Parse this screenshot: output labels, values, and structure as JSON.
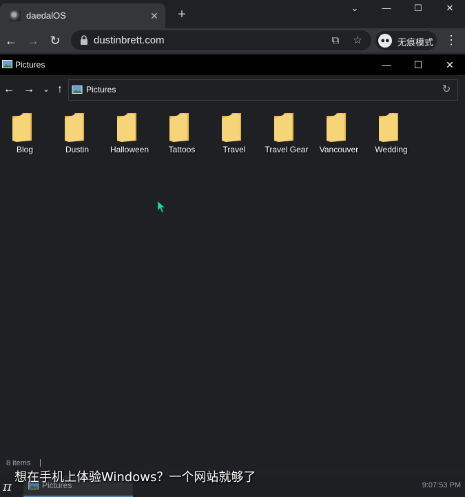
{
  "browser": {
    "tab_title": "daedalOS",
    "tab_close": "✕",
    "new_tab": "+",
    "url": "dustinbrett.com",
    "incognito_label": "无痕模式",
    "window_controls": {
      "dropdown": "⌄",
      "minimize": "—",
      "maximize": "☐",
      "close": "✕"
    }
  },
  "window": {
    "title": "Pictures",
    "address": "Pictures",
    "controls": {
      "minimize": "—",
      "maximize": "☐",
      "close": "✕"
    }
  },
  "folders": [
    {
      "label": "Blog"
    },
    {
      "label": "Dustin"
    },
    {
      "label": "Halloween"
    },
    {
      "label": "Tattoos"
    },
    {
      "label": "Travel"
    },
    {
      "label": "Travel Gear"
    },
    {
      "label": "Vancouver"
    },
    {
      "label": "Wedding"
    }
  ],
  "status": {
    "items": "8 items"
  },
  "subtitle": "想在手机上体验Windows？一个网站就够了",
  "taskbar": {
    "start_glyph": "π",
    "entry_label": "Pictures",
    "clock": "9:07:53 PM"
  },
  "colors": {
    "folder": "#f6d57a",
    "folder_dark": "#e6b64c",
    "cursor": "#1fd6b0"
  }
}
